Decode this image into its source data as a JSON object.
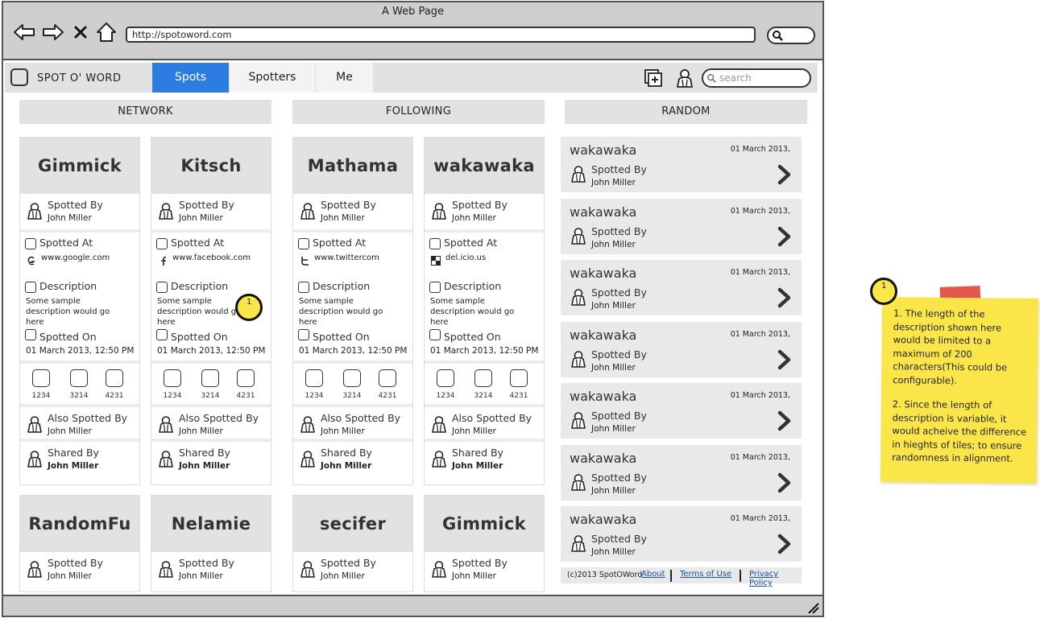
{
  "browser": {
    "title": "A Web Page",
    "url": "http://spotoword.com"
  },
  "nav": {
    "logo": "SPOT O' WORD",
    "tabs": [
      "Spots",
      "Spotters",
      "Me"
    ],
    "search_placeholder": "search",
    "accent": "#2d7ce2"
  },
  "columns": [
    "NETWORK",
    "FOLLOWING",
    "RANDOM"
  ],
  "labels": {
    "spotted_by": "Spotted By",
    "spotted_at": "Spotted At",
    "description": "Description",
    "spotted_on": "Spotted On",
    "also_spotted_by": "Also Spotted By",
    "shared_by": "Shared By"
  },
  "cards": [
    {
      "title": "Gimmick",
      "spotted_by": "John Miller",
      "site_icon": "google-icon",
      "site": "www.google.com",
      "description": "Some sample description would go here",
      "date": "01 March 2013, 12:50 PM",
      "stats": [
        "1234",
        "3214",
        "4231"
      ],
      "also_by": "John Miller",
      "shared_by": "John Miller"
    },
    {
      "title": "Kitsch",
      "spotted_by": "John Miller",
      "site_icon": "facebook-icon",
      "site": "www.facebook.com",
      "description": "Some sample description would go here",
      "date": "01 March 2013, 12:50 PM",
      "stats": [
        "1234",
        "3214",
        "4231"
      ],
      "also_by": "John Miller",
      "shared_by": "John Miller"
    },
    {
      "title": "Mathama",
      "spotted_by": "John Miller",
      "site_icon": "twitter-icon",
      "site": "www.twittercom",
      "description": "Some sample description would go here",
      "date": "01 March 2013, 12:50 PM",
      "stats": [
        "1234",
        "3214",
        "4231"
      ],
      "also_by": "John Miller",
      "shared_by": "John Miller"
    },
    {
      "title": "wakawaka",
      "spotted_by": "John Miller",
      "site_icon": "delicious-icon",
      "site": "del.icio.us",
      "description": "Some sample description would go here",
      "date": "01 March 2013, 12:50 PM",
      "stats": [
        "1234",
        "3214",
        "4231"
      ],
      "also_by": "John Miller",
      "shared_by": "John Miller"
    }
  ],
  "cards_row2": [
    {
      "title": "RandomFu",
      "spotted_by": "John Miller"
    },
    {
      "title": "Nelamie",
      "spotted_by": "John Miller"
    },
    {
      "title": "secifer",
      "spotted_by": "John Miller"
    },
    {
      "title": "Gimmick",
      "spotted_by": "John Miller"
    }
  ],
  "random": [
    {
      "title": "wakawaka",
      "date": "01 March 2013,",
      "spotted_by": "John Miller"
    },
    {
      "title": "wakawaka",
      "date": "01 March 2013,",
      "spotted_by": "John Miller"
    },
    {
      "title": "wakawaka",
      "date": "01 March 2013,",
      "spotted_by": "John Miller"
    },
    {
      "title": "wakawaka",
      "date": "01 March 2013,",
      "spotted_by": "John Miller"
    },
    {
      "title": "wakawaka",
      "date": "01 March 2013,",
      "spotted_by": "John Miller"
    },
    {
      "title": "wakawaka",
      "date": "01 March 2013,",
      "spotted_by": "John Miller"
    },
    {
      "title": "wakawaka",
      "date": "01 March 2013,",
      "spotted_by": "John Miller"
    }
  ],
  "footer": {
    "copyright": "(c)2013 SpotOWord",
    "links": [
      "About",
      "Terms of Use",
      "Privacy Policy"
    ]
  },
  "annotation": {
    "marker": "1",
    "note_1": "1. The length of the description shown here would be limited to a maximum of 200 characters(This could be configurable).",
    "note_2": "2.  Since the length of description is variable, it would acheive the difference in hieghts of tiles; to ensure randomness in alignment.",
    "note_color": "#fbe64a",
    "tape_color": "#e04437"
  }
}
